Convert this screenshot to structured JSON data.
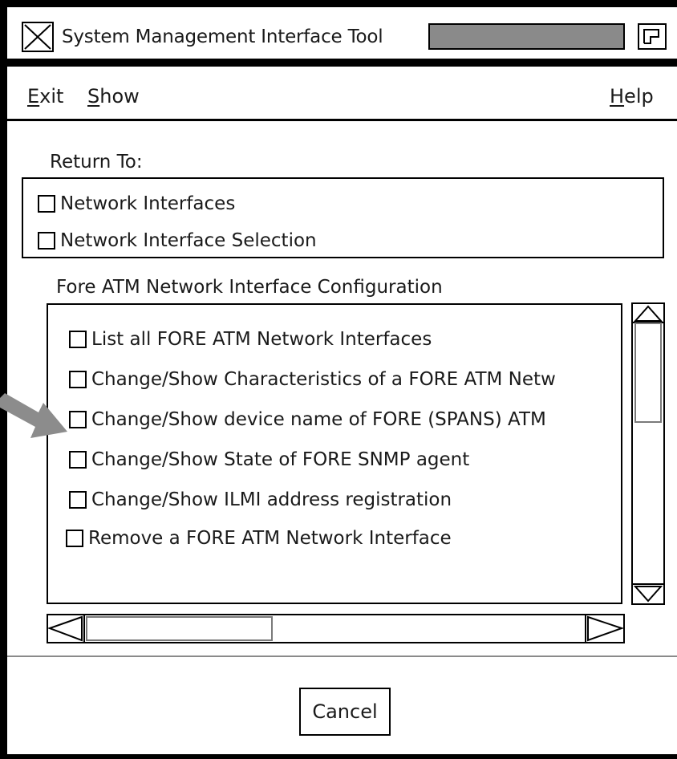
{
  "window": {
    "title": "System Management Interface Tool"
  },
  "menubar": {
    "exit": {
      "accel": "E",
      "rest": "xit"
    },
    "show": {
      "accel": "S",
      "rest": "how"
    },
    "help": {
      "accel": "H",
      "rest": "elp"
    }
  },
  "return_to": {
    "label": "Return To:",
    "items": [
      "Network Interfaces",
      "Network Interface Selection"
    ]
  },
  "config": {
    "title": "Fore ATM Network Interface Configuration",
    "items": [
      "List all FORE ATM Network Interfaces",
      "Change/Show Characteristics of a FORE ATM Netw",
      "Change/Show device name of FORE (SPANS) ATM",
      "Change/Show State of FORE SNMP agent",
      "Change/Show ILMI address registration",
      "Remove a FORE ATM Network Interface"
    ]
  },
  "buttons": {
    "cancel": "Cancel"
  },
  "colors": {
    "frame": "#000000",
    "title_fill": "#8a8a8a",
    "pointer_arrow": "#8c8c8c"
  },
  "icons": {
    "close": "x-close-icon",
    "maximize": "window-maximize-icon",
    "pointer": "callout-arrow-icon"
  }
}
